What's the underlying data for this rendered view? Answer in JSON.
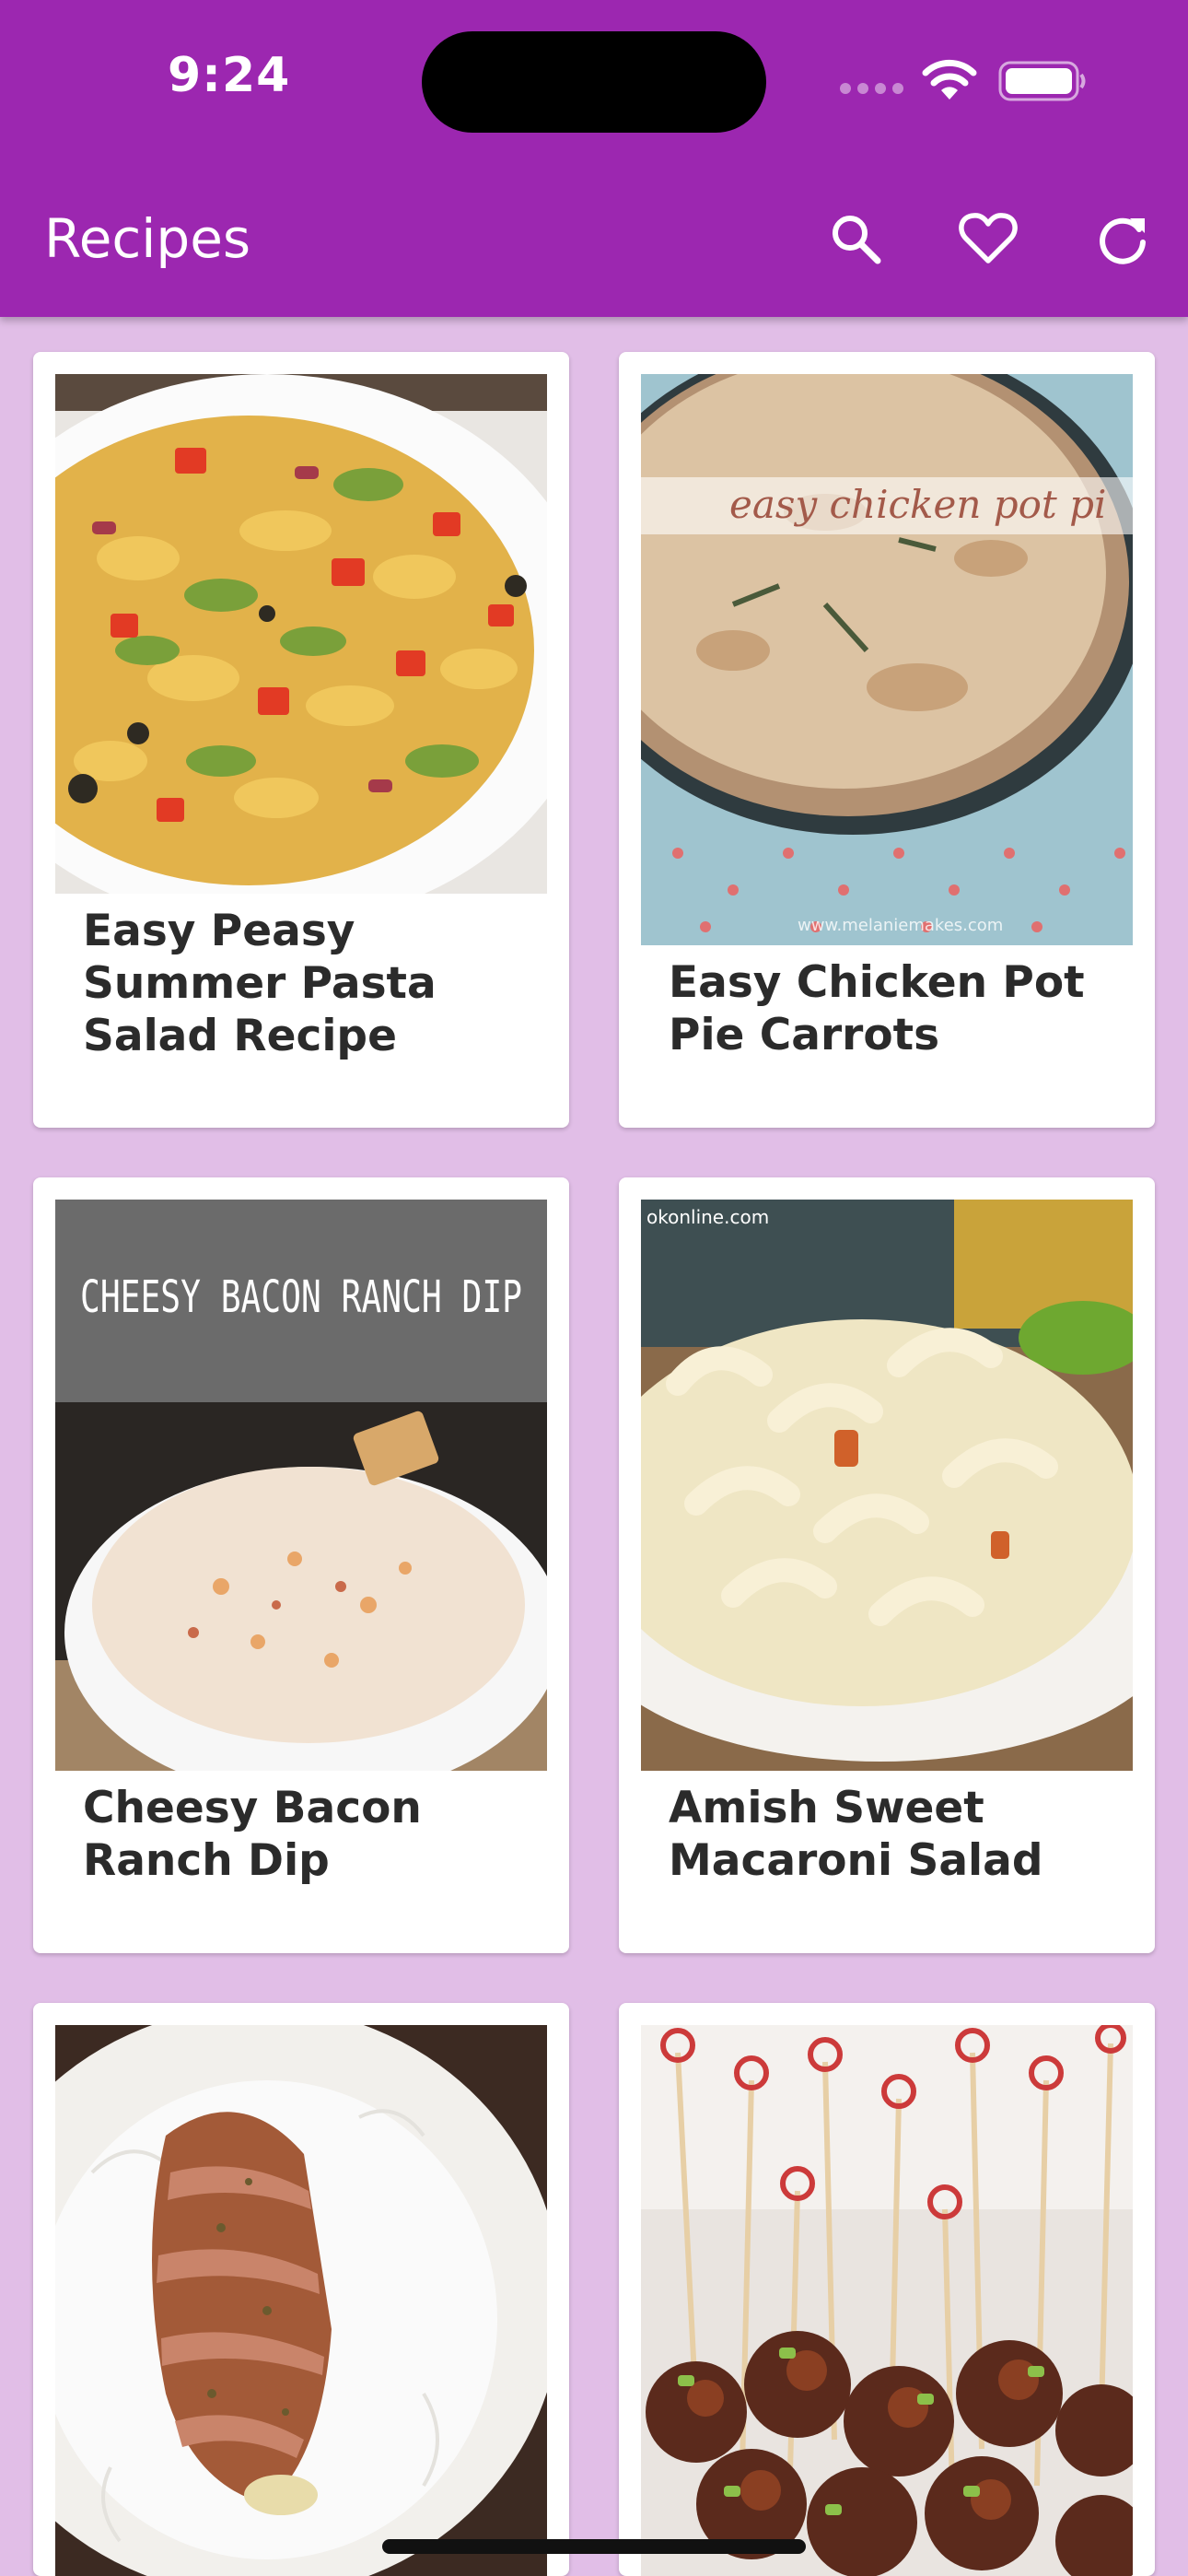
{
  "status_bar": {
    "time": "9:24"
  },
  "app_bar": {
    "title": "Recipes",
    "actions": [
      {
        "name": "search",
        "icon": "search-icon"
      },
      {
        "name": "favorites",
        "icon": "heart-icon"
      },
      {
        "name": "refresh",
        "icon": "refresh-icon"
      }
    ]
  },
  "colors": {
    "primary": "#9c27b0",
    "background": "#e1bee7",
    "card": "#ffffff"
  },
  "recipes": [
    {
      "name": "Easy Peasy Summer Pasta Salad Recipe"
    },
    {
      "name": "Easy Chicken Pot Pie Carrots",
      "image_caption": "easy chicken pot pi",
      "image_watermark": "www.melaniemakes.com"
    },
    {
      "name": "Cheesy Bacon Ranch Dip",
      "image_caption": "CHEESY BACON RANCH DIP"
    },
    {
      "name": "Amish Sweet Macaroni Salad",
      "image_watermark": "okonline.com"
    },
    {
      "name": ""
    },
    {
      "name": ""
    }
  ]
}
